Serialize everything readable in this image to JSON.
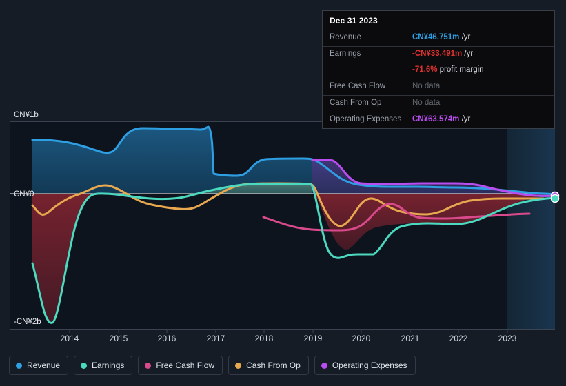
{
  "chart_data": {
    "type": "area",
    "title": "",
    "xlabel": "",
    "ylabel": "",
    "currency": "CN¥",
    "grid": true,
    "legend_position": "bottom-left",
    "ylim": [
      -2300000000,
      1200000000
    ],
    "yticks": [
      {
        "value": 1000000000,
        "label": "CN¥1b"
      },
      {
        "value": 0,
        "label": "CN¥0"
      },
      {
        "value": -2000000000,
        "label": "-CN¥2b"
      }
    ],
    "xticks": [
      "2014",
      "2015",
      "2016",
      "2017",
      "2018",
      "2019",
      "2020",
      "2021",
      "2022",
      "2023"
    ],
    "series": [
      {
        "name": "Revenue",
        "color": "#2e9fe3",
        "fill": "#1b4a6e",
        "values": [
          {
            "x": 2013.5,
            "y": 0.72
          },
          {
            "x": 2014.0,
            "y": 0.7
          },
          {
            "x": 2014.5,
            "y": 0.68
          },
          {
            "x": 2015.0,
            "y": 0.56
          },
          {
            "x": 2015.3,
            "y": 0.64
          },
          {
            "x": 2015.6,
            "y": 0.82
          },
          {
            "x": 2016.0,
            "y": 0.79
          },
          {
            "x": 2016.5,
            "y": 0.79
          },
          {
            "x": 2016.8,
            "y": 0.84
          },
          {
            "x": 2017.0,
            "y": 0.83
          },
          {
            "x": 2017.2,
            "y": 0.28
          },
          {
            "x": 2017.6,
            "y": 0.25
          },
          {
            "x": 2018.0,
            "y": 0.19
          },
          {
            "x": 2018.3,
            "y": 0.47
          },
          {
            "x": 2018.8,
            "y": 0.48
          },
          {
            "x": 2019.0,
            "y": 0.47
          },
          {
            "x": 2019.5,
            "y": 0.15
          },
          {
            "x": 2020.0,
            "y": 0.055
          },
          {
            "x": 2020.5,
            "y": 0.11
          },
          {
            "x": 2021.0,
            "y": 0.12
          },
          {
            "x": 2021.5,
            "y": 0.115
          },
          {
            "x": 2022.0,
            "y": 0.11
          },
          {
            "x": 2022.5,
            "y": 0.095
          },
          {
            "x": 2023.0,
            "y": 0.065
          },
          {
            "x": 2023.5,
            "y": 0.047
          }
        ]
      },
      {
        "name": "Earnings",
        "color": "#4bd9c0",
        "fill": "#7a2230",
        "values": [
          {
            "x": 2013.5,
            "y": -1.75
          },
          {
            "x": 2013.8,
            "y": -2.05
          },
          {
            "x": 2014.1,
            "y": -1.55
          },
          {
            "x": 2014.4,
            "y": -0.95
          },
          {
            "x": 2014.8,
            "y": -0.45
          },
          {
            "x": 2015.2,
            "y": -0.12
          },
          {
            "x": 2015.6,
            "y": 0.0
          },
          {
            "x": 2016.0,
            "y": 0.03
          },
          {
            "x": 2016.5,
            "y": 0.05
          },
          {
            "x": 2017.0,
            "y": 0.08
          },
          {
            "x": 2017.5,
            "y": 0.1
          },
          {
            "x": 2018.0,
            "y": 0.105
          },
          {
            "x": 2018.6,
            "y": 0.12
          },
          {
            "x": 2018.9,
            "y": 0.12
          },
          {
            "x": 2019.1,
            "y": -0.3
          },
          {
            "x": 2019.4,
            "y": -0.6
          },
          {
            "x": 2019.7,
            "y": -0.72
          },
          {
            "x": 2020.0,
            "y": -0.5
          },
          {
            "x": 2020.3,
            "y": -0.47
          },
          {
            "x": 2020.7,
            "y": -0.33
          },
          {
            "x": 2021.0,
            "y": -0.26
          },
          {
            "x": 2021.5,
            "y": -0.27
          },
          {
            "x": 2022.0,
            "y": -0.24
          },
          {
            "x": 2022.5,
            "y": -0.13
          },
          {
            "x": 2023.0,
            "y": -0.06
          },
          {
            "x": 2023.5,
            "y": -0.033
          }
        ]
      },
      {
        "name": "Free Cash Flow",
        "color": "#d84a8c",
        "fill": "none",
        "values": [
          {
            "x": 2018.0,
            "y": -0.28
          },
          {
            "x": 2018.5,
            "y": -0.38
          },
          {
            "x": 2019.0,
            "y": -0.43
          },
          {
            "x": 2019.6,
            "y": -0.44
          },
          {
            "x": 2019.9,
            "y": -0.3
          },
          {
            "x": 2020.2,
            "y": -0.11
          },
          {
            "x": 2020.5,
            "y": -0.04
          },
          {
            "x": 2020.8,
            "y": -0.09
          },
          {
            "x": 2021.2,
            "y": -0.09
          },
          {
            "x": 2021.6,
            "y": -0.09
          },
          {
            "x": 2022.0,
            "y": -0.08
          },
          {
            "x": 2022.5,
            "y": -0.06
          },
          {
            "x": 2022.9,
            "y": -0.05
          }
        ]
      },
      {
        "name": "Cash From Op",
        "color": "#e8a84f",
        "fill": "none",
        "values": [
          {
            "x": 2013.5,
            "y": -0.16
          },
          {
            "x": 2013.9,
            "y": -0.23
          },
          {
            "x": 2014.4,
            "y": -0.14
          },
          {
            "x": 2015.0,
            "y": 0.04
          },
          {
            "x": 2015.4,
            "y": 0.09
          },
          {
            "x": 2015.9,
            "y": 0.04
          },
          {
            "x": 2016.4,
            "y": -0.02
          },
          {
            "x": 2016.9,
            "y": -0.08
          },
          {
            "x": 2017.3,
            "y": -0.1
          },
          {
            "x": 2017.8,
            "y": -0.07
          },
          {
            "x": 2018.3,
            "y": -0.02
          },
          {
            "x": 2018.8,
            "y": 0.075
          },
          {
            "x": 2019.0,
            "y": 0.08
          },
          {
            "x": 2019.3,
            "y": -0.2
          },
          {
            "x": 2019.7,
            "y": -0.33
          },
          {
            "x": 2020.0,
            "y": -0.22
          },
          {
            "x": 2020.3,
            "y": 0.02
          },
          {
            "x": 2020.6,
            "y": -0.02
          },
          {
            "x": 2021.0,
            "y": -0.04
          },
          {
            "x": 2021.4,
            "y": -0.15
          },
          {
            "x": 2021.9,
            "y": -0.16
          },
          {
            "x": 2022.3,
            "y": -0.1
          },
          {
            "x": 2022.8,
            "y": -0.03
          },
          {
            "x": 2023.2,
            "y": -0.025
          }
        ]
      },
      {
        "name": "Operating Expenses",
        "color": "#b94df0",
        "fill": "#3b2f68",
        "values": [
          {
            "x": 2019.0,
            "y": 0.42
          },
          {
            "x": 2019.3,
            "y": 0.41
          },
          {
            "x": 2019.7,
            "y": 0.22
          },
          {
            "x": 2020.0,
            "y": 0.2
          },
          {
            "x": 2020.4,
            "y": 0.175
          },
          {
            "x": 2021.0,
            "y": 0.145
          },
          {
            "x": 2021.5,
            "y": 0.14
          },
          {
            "x": 2022.0,
            "y": 0.135
          },
          {
            "x": 2022.5,
            "y": 0.13
          },
          {
            "x": 2023.0,
            "y": 0.1
          },
          {
            "x": 2023.5,
            "y": 0.064
          }
        ]
      }
    ],
    "endpoints": [
      {
        "series": "Operating Expenses",
        "color": "#b94df0",
        "y": 0.064
      },
      {
        "series": "Earnings",
        "color": "#4bd9c0",
        "y": -0.033
      }
    ]
  },
  "tooltip": {
    "date": "Dec 31 2023",
    "rows": [
      {
        "key": "Revenue",
        "value": "CN¥46.751m",
        "unit": " /yr",
        "color": "#2e9fe3",
        "nodata": false
      },
      {
        "key": "Earnings",
        "value": "-CN¥33.491m",
        "unit": " /yr",
        "color": "#e03131",
        "nodata": false
      },
      {
        "key": "",
        "value": "-71.6%",
        "unit": " profit margin",
        "color": "#e03131",
        "nodata": false
      },
      {
        "key": "Free Cash Flow",
        "value": "No data",
        "unit": "",
        "color": "#62686f",
        "nodata": true
      },
      {
        "key": "Cash From Op",
        "value": "No data",
        "unit": "",
        "color": "#62686f",
        "nodata": true
      },
      {
        "key": "Operating Expenses",
        "value": "CN¥63.574m",
        "unit": " /yr",
        "color": "#b94df0",
        "nodata": false
      }
    ]
  },
  "legend": {
    "items": [
      {
        "label": "Revenue",
        "color": "#2e9fe3"
      },
      {
        "label": "Earnings",
        "color": "#4bd9c0"
      },
      {
        "label": "Free Cash Flow",
        "color": "#d84a8c"
      },
      {
        "label": "Cash From Op",
        "color": "#e8a84f"
      },
      {
        "label": "Operating Expenses",
        "color": "#b94df0"
      }
    ]
  },
  "theme": {
    "background": "#151c26",
    "plot_background": "#0e141d",
    "grid_color": "#2b3440",
    "zero_line": "#c8ccd2",
    "axis_text": "#d3d9e0"
  }
}
